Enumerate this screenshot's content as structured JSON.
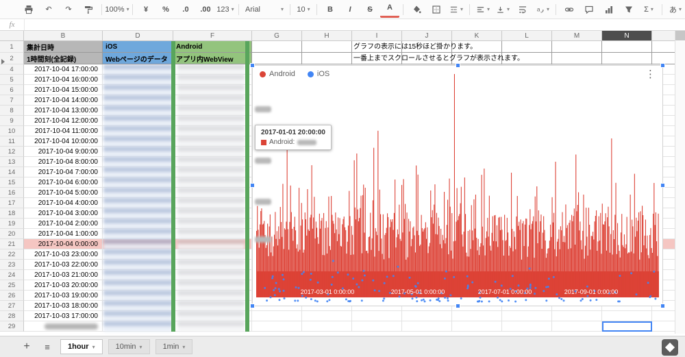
{
  "icons": {
    "undo": "↶",
    "redo": "↷",
    "kebab": "⋮",
    "all_sheets": "≡",
    "add": "+"
  },
  "toolbar": {
    "zoom_value": "100%",
    "currency_label": "¥",
    "percent_label": "%",
    "dec0_label": ".0",
    "dec00_label": ".00",
    "number_format_label": "123",
    "font_name": "Arial",
    "font_size": "10",
    "bold_label": "B",
    "italic_label": "I",
    "strikethrough_label": "S",
    "text_color_label": "A",
    "functions_label": "Σ",
    "ime_label": "あ"
  },
  "formula_bar": {
    "label": "fx",
    "value": ""
  },
  "sheet": {
    "col_headers": [
      "B",
      "D",
      "F",
      "G",
      "H",
      "I",
      "J",
      "K",
      "L",
      "M",
      "N"
    ],
    "selected_col": "N",
    "hidden_rows_note": "row 3 hidden",
    "band": {
      "b1": "集計日時",
      "b2": "1時間刻(全記録)",
      "d1": "iOS",
      "d2": "Webページのデータ",
      "f1": "Android",
      "f2": "アプリ内WebView"
    },
    "notes": [
      "グラフの表示には15秒ほど掛かります。",
      "一番上までスクロールさせるとグラフが表示されます。"
    ],
    "colors": {
      "b_header": "#b7b7b7",
      "d_header": "#6fa8dc",
      "f_header": "#93c47d",
      "row_highlight": "#f5c6c2",
      "stripe_green": "#58a55c"
    },
    "rows": [
      {
        "n": "4",
        "b": "2017-10-04 17:00:00"
      },
      {
        "n": "5",
        "b": "2017-10-04 16:00:00"
      },
      {
        "n": "6",
        "b": "2017-10-04 15:00:00"
      },
      {
        "n": "7",
        "b": "2017-10-04 14:00:00"
      },
      {
        "n": "8",
        "b": "2017-10-04 13:00:00"
      },
      {
        "n": "9",
        "b": "2017-10-04 12:00:00"
      },
      {
        "n": "10",
        "b": "2017-10-04 11:00:00"
      },
      {
        "n": "11",
        "b": "2017-10-04 10:00:00"
      },
      {
        "n": "12",
        "b": "2017-10-04 9:00:00"
      },
      {
        "n": "13",
        "b": "2017-10-04 8:00:00"
      },
      {
        "n": "14",
        "b": "2017-10-04 7:00:00"
      },
      {
        "n": "15",
        "b": "2017-10-04 6:00:00"
      },
      {
        "n": "16",
        "b": "2017-10-04 5:00:00"
      },
      {
        "n": "17",
        "b": "2017-10-04 4:00:00"
      },
      {
        "n": "18",
        "b": "2017-10-04 3:00:00"
      },
      {
        "n": "19",
        "b": "2017-10-04 2:00:00"
      },
      {
        "n": "20",
        "b": "2017-10-04 1:00:00"
      },
      {
        "n": "21",
        "b": "2017-10-04 0:00:00",
        "hl": true
      },
      {
        "n": "22",
        "b": "2017-10-03 23:00:00"
      },
      {
        "n": "23",
        "b": "2017-10-03 22:00:00"
      },
      {
        "n": "24",
        "b": "2017-10-03 21:00:00"
      },
      {
        "n": "25",
        "b": "2017-10-03 20:00:00"
      },
      {
        "n": "26",
        "b": "2017-10-03 19:00:00"
      },
      {
        "n": "27",
        "b": "2017-10-03 18:00:00"
      },
      {
        "n": "28",
        "b": "2017-10-03 17:00:00"
      },
      {
        "n": "29",
        "b": "",
        "blur": true
      }
    ]
  },
  "chart": {
    "legend": [
      {
        "label": "Android",
        "color": "#db4437"
      },
      {
        "label": "iOS",
        "color": "#4285f4"
      }
    ],
    "tooltip": {
      "title": "2017-01-01 20:00:00",
      "series_label": "Android:",
      "value": "(blurred)"
    },
    "x_labels": [
      "2017-03-01 0:00:00",
      "2017-05-01 0:00:00",
      "2017-07-01 0:00:00",
      "2017-09-01 0:00:00"
    ]
  },
  "chart_data": {
    "type": "bar",
    "title": "",
    "series": [
      {
        "name": "Android",
        "color": "#db4437"
      },
      {
        "name": "iOS",
        "color": "#4285f4"
      }
    ],
    "x_axis": {
      "type": "datetime",
      "range": [
        "2017-01-01 0:00:00",
        "2017-10-04 17:00:00"
      ],
      "tick_labels": [
        "2017-03-01 0:00:00",
        "2017-05-01 0:00:00",
        "2017-07-01 0:00:00",
        "2017-09-01 0:00:00"
      ]
    },
    "y_axis": {
      "tick_labels": "blurred / unreadable"
    },
    "legend_position": "top-left",
    "tooltip": {
      "title": "2017-01-01 20:00:00",
      "series": "Android",
      "value": "blurred"
    },
    "note": "dense hourly series Jan–Oct 2017; individual values not readable in screenshot"
  },
  "tabs": {
    "items": [
      {
        "label": "1hour",
        "active": true
      },
      {
        "label": "10min",
        "active": false
      },
      {
        "label": "1min",
        "active": false
      }
    ]
  }
}
